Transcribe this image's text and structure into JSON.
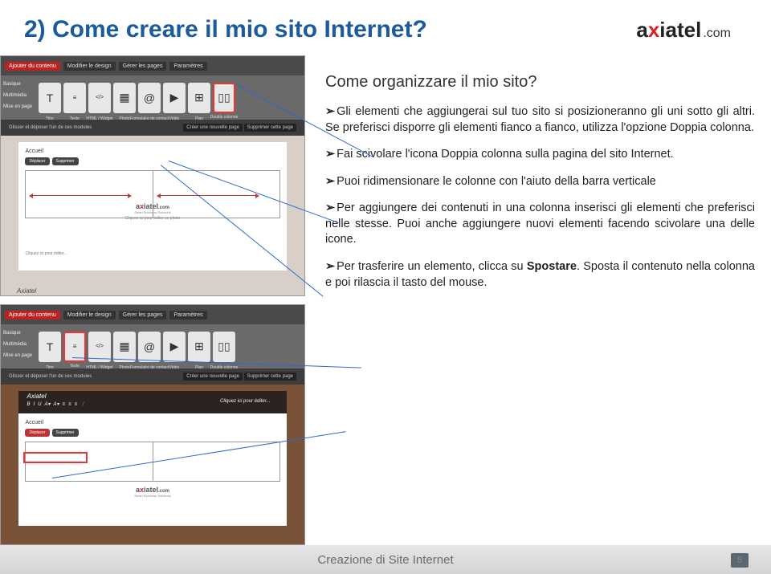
{
  "header": {
    "title": "2) Come creare il mio sito Internet?",
    "logo": {
      "brand_pre": "a",
      "brand_x": "x",
      "brand_post": "iatel",
      "dotcom": ".com"
    }
  },
  "subtitle": "Come organizzare il mio sito?",
  "bullets": [
    "Gli elementi che aggiungerai sul tuo sito si posizioneranno gli uni sotto gli altri. Se preferisci disporre gli elementi fianco a fianco, utilizza l'opzione Doppia colonna.",
    "Fai scivolare l'icona Doppia colonna sulla pagina del sito Internet.",
    "Puoi ridimensionare le colonne con l'aiuto della barra verticale",
    "Per aggiungere dei contenuti in una colonna inserisci gli elementi che preferisci nelle stesse. Puoi anche aggiungere nuovi elementi facendo scivolare una delle icone.",
    "Per trasferire un elemento, clicca su Spostare. Sposta il contenuto nella colonna e poi rilascia il tasto del mouse."
  ],
  "bold_word": "Spostare",
  "screenshot_labels": {
    "topbar": [
      "Ajouter du contenu",
      "Modifier le design",
      "Gérer les pages",
      "Paramètres"
    ],
    "sidebar": [
      "Basique",
      "Multimédia",
      "Mise en page"
    ],
    "toolbar_items": [
      "Titre",
      "Texte",
      "HTML / Widget",
      "Photo",
      "Formulaire de contact",
      "Vidéo",
      "Plan",
      "Double colonne"
    ],
    "subbar_hint": "Glisser et déposer l'un de ces modules",
    "subbar_buttons": [
      "Créer une nouvelle page",
      "Supprimer cette page"
    ],
    "page_title": "Accueil",
    "page_buttons": [
      "Déplacer",
      "Supprimer"
    ],
    "site_name": "Axiatel",
    "logo_tagline": "Smart Business Solutions",
    "click_edit": "Cliquez ici pour éditer ce photo",
    "click_edit2": "Cliquez ici pour éditer...",
    "placeholder_text": "Cliquez ici pour éditer..."
  },
  "footer": {
    "text": "Creazione di Site Internet",
    "page": "5"
  }
}
